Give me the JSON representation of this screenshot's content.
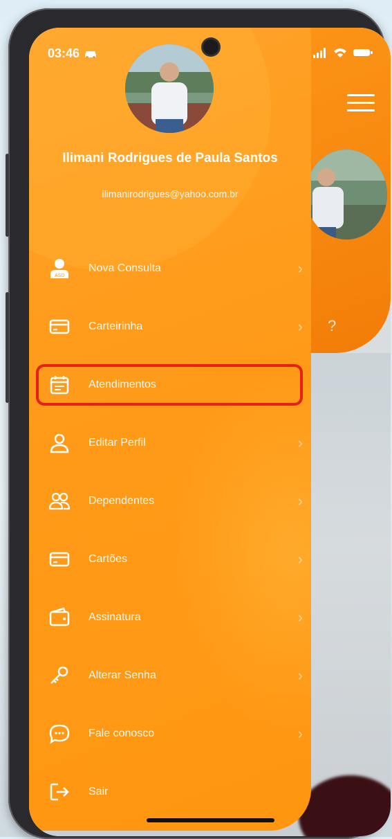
{
  "status_bar": {
    "time": "03:46"
  },
  "profile": {
    "name": "Ilimani Rodrigues de Paula Santos",
    "email": "ilimanirodrigues@yahoo.com.br"
  },
  "menu": {
    "items": [
      {
        "label": "Nova Consulta",
        "icon": "doctor-icon"
      },
      {
        "label": "Carteirinha",
        "icon": "card-icon"
      },
      {
        "label": "Atendimentos",
        "icon": "calendar-icon",
        "highlighted": true
      },
      {
        "label": "Editar Perfil",
        "icon": "user-icon"
      },
      {
        "label": "Dependentes",
        "icon": "users-icon"
      },
      {
        "label": "Cartões",
        "icon": "credit-card-icon"
      },
      {
        "label": "Assinatura",
        "icon": "wallet-icon"
      },
      {
        "label": "Alterar Senha",
        "icon": "key-icon"
      },
      {
        "label": "Fale conosco",
        "icon": "chat-icon"
      },
      {
        "label": "Sair",
        "icon": "logout-icon"
      }
    ]
  },
  "colors": {
    "accent": "#ff9b1a",
    "highlight_box": "#e8201a"
  }
}
